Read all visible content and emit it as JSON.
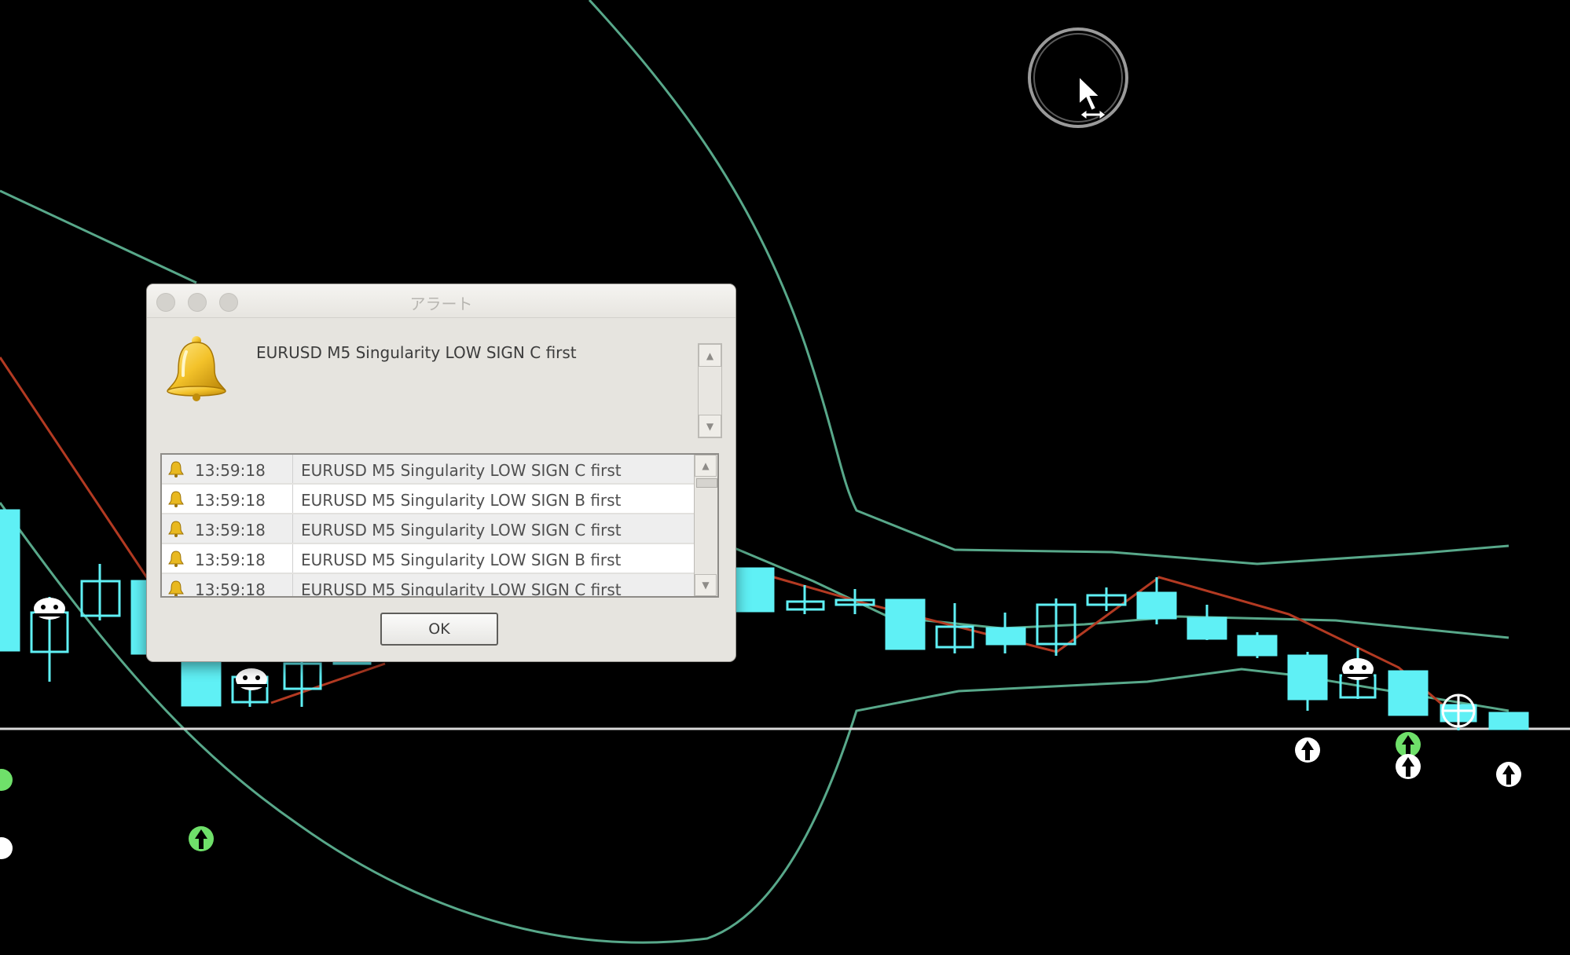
{
  "dialog": {
    "title": "アラート",
    "message": "EURUSD M5 Singularity LOW SIGN C first",
    "ok_label": "OK",
    "icon": "bell-icon"
  },
  "alerts": [
    {
      "time": "13:59:18",
      "text": "EURUSD M5 Singularity LOW SIGN C first"
    },
    {
      "time": "13:59:18",
      "text": "EURUSD M5 Singularity LOW SIGN B first"
    },
    {
      "time": "13:59:18",
      "text": "EURUSD M5 Singularity LOW SIGN C first"
    },
    {
      "time": "13:59:18",
      "text": "EURUSD M5 Singularity LOW SIGN B first"
    },
    {
      "time": "13:59:18",
      "text": "EURUSD M5 Singularity LOW SIGN C first"
    }
  ],
  "colors": {
    "background": "#000000",
    "candle": "#5ff0f5",
    "band": "#58a88a",
    "zigzag": "#b33a22",
    "level_line": "#d9d9d9",
    "arrow_white": "#ffffff",
    "arrow_green": "#6fe06a"
  },
  "icons": [
    "bell-icon",
    "mouse-cursor-icon",
    "up-arrow-signal-icon",
    "robot-signal-icon",
    "scroll-up-icon",
    "scroll-down-icon"
  ]
}
